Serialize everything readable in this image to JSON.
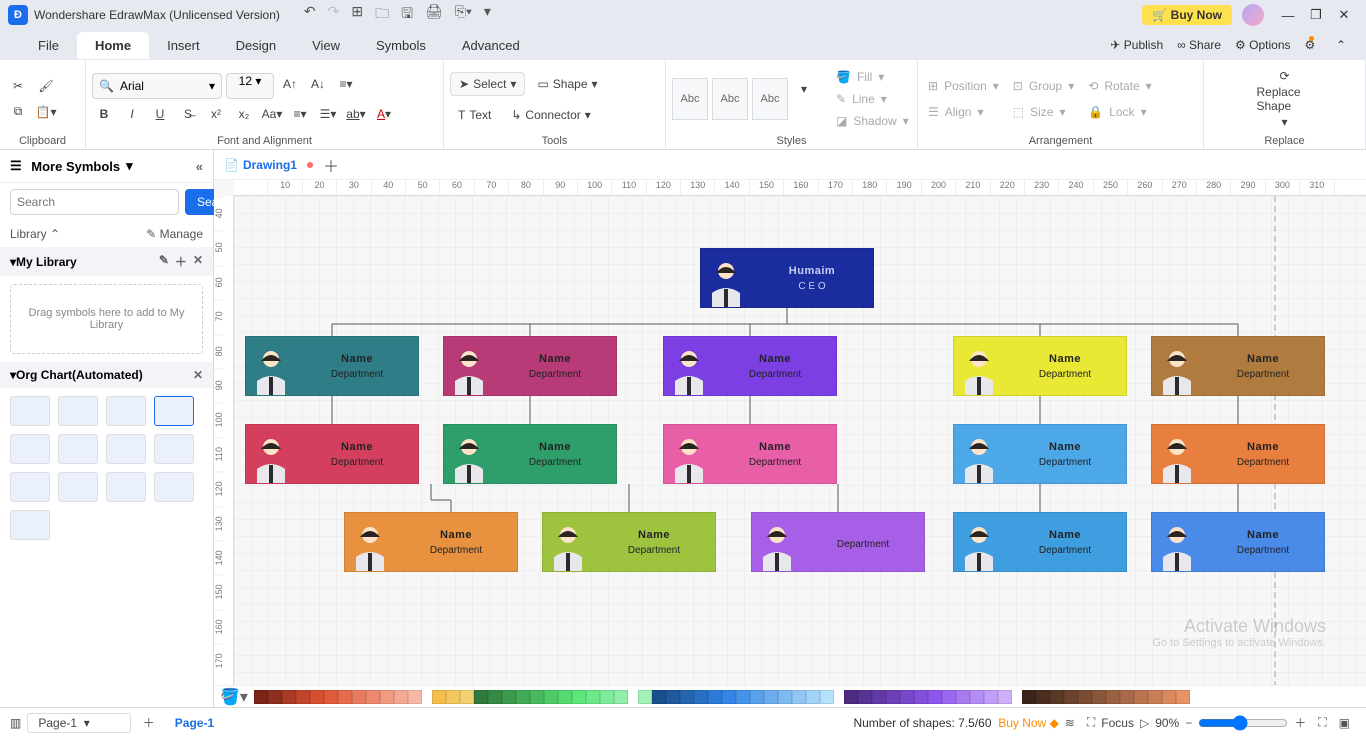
{
  "titlebar": {
    "title": "Wondershare EdrawMax (Unlicensed Version)",
    "buy": "Buy Now"
  },
  "menus": [
    "File",
    "Home",
    "Insert",
    "Design",
    "View",
    "Symbols",
    "Advanced"
  ],
  "menu_right": {
    "publish": "Publish",
    "share": "Share",
    "options": "Options"
  },
  "ribbon": {
    "font_name": "Arial",
    "font_size": "12",
    "select": "Select",
    "shape": "Shape",
    "text": "Text",
    "connector": "Connector",
    "abc": "Abc",
    "fill": "Fill",
    "line": "Line",
    "shadow": "Shadow",
    "position": "Position",
    "align": "Align",
    "group": "Group",
    "size": "Size",
    "rotate": "Rotate",
    "lock": "Lock",
    "replace_shape": "Replace Shape",
    "groups": {
      "clipboard": "Clipboard",
      "font": "Font and Alignment",
      "tools": "Tools",
      "styles": "Styles",
      "arrangement": "Arrangement",
      "replace": "Replace"
    }
  },
  "sidebar": {
    "more": "More Symbols",
    "search_ph": "Search",
    "search_btn": "Search",
    "library": "Library",
    "manage": "Manage",
    "mylib": "My Library",
    "drop": "Drag symbols here to add to My Library",
    "org": "Org Chart(Automated)"
  },
  "doc_tab": "Drawing1",
  "nodes": {
    "ceo": {
      "name": "Humaim",
      "dept": "C E O"
    },
    "default": {
      "name": "Name",
      "dept": "Department"
    }
  },
  "ruler_h": [
    "",
    "10",
    "20",
    "30",
    "40",
    "50",
    "60",
    "70",
    "80",
    "90",
    "100",
    "110",
    "120",
    "130",
    "140",
    "150",
    "160",
    "170",
    "180",
    "190",
    "200",
    "210",
    "220",
    "230",
    "240",
    "250",
    "260",
    "270",
    "280",
    "290",
    "300",
    "310"
  ],
  "ruler_v": [
    "40",
    "50",
    "60",
    "70",
    "80",
    "90",
    "100",
    "110",
    "120",
    "130",
    "140",
    "150",
    "160",
    "170"
  ],
  "status": {
    "page": "Page-1",
    "shapes": "Number of shapes: 7.5/60",
    "buy": "Buy Now",
    "focus": "Focus",
    "zoom": "90%"
  },
  "watermark": {
    "big": "Activate Windows",
    "small": "Go to Settings to activate Windows."
  },
  "palette_colors": [
    "#7a2518",
    "#8e2e1f",
    "#a83a26",
    "#c2442c",
    "#d64f33",
    "#e05a3c",
    "#e66b4d",
    "#ea7b5e",
    "#ee8a70",
    "#f19a82",
    "#f4a994",
    "#f7b9a6",
    "#f6bf4c",
    "#f5c85e",
    "#f4d170",
    "#2f7a3e",
    "#358a46",
    "#3b9a4e",
    "#41aa56",
    "#47ba5f",
    "#4eca67",
    "#54da70",
    "#5ae879",
    "#6cea89",
    "#7eed99",
    "#90efa9",
    "#a2f2b9",
    "#1a4f8e",
    "#1f5aa0",
    "#2465b2",
    "#2970c5",
    "#2e7bd7",
    "#3386e8",
    "#4593ea",
    "#58a0ed",
    "#6badf0",
    "#7dbaf2",
    "#90c7f5",
    "#a2d4f8",
    "#b5e1fa",
    "#4b2c82",
    "#563394",
    "#613aa6",
    "#6c41b8",
    "#7748ca",
    "#824fdc",
    "#8d56ee",
    "#9a68f0",
    "#a77af2",
    "#b48cf5",
    "#c19ef7",
    "#cfb0fa",
    "#3b2418",
    "#4a2e1f",
    "#5a3826",
    "#6a422d",
    "#7a4c34",
    "#8a563b",
    "#9a6042",
    "#aa6a49",
    "#ba7450",
    "#ca7e57",
    "#da885e",
    "#e89265"
  ]
}
